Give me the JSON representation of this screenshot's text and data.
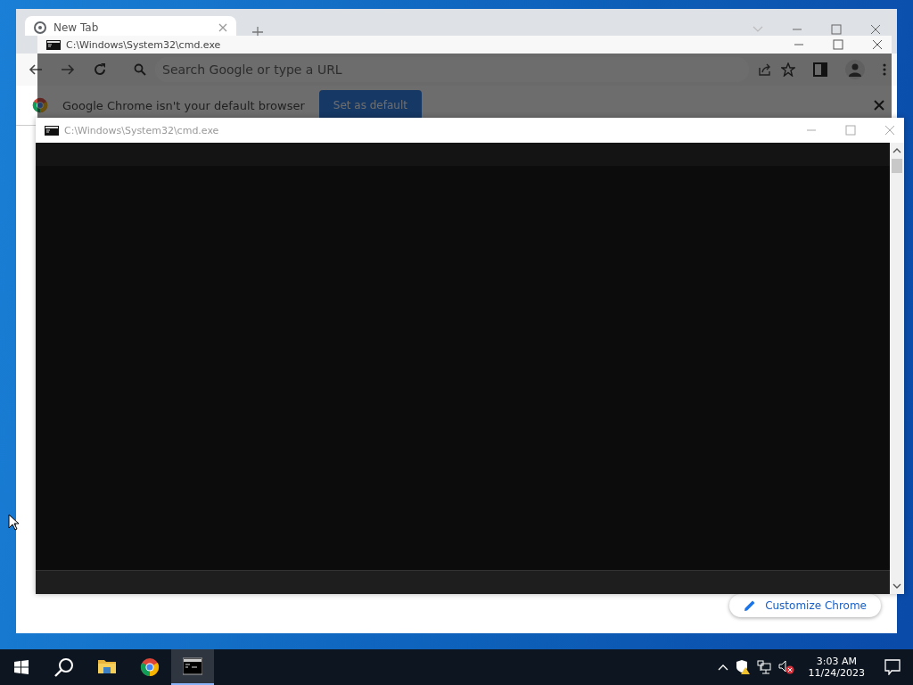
{
  "browser": {
    "tab": {
      "title": "New Tab"
    },
    "address_bar": {
      "placeholder": "Search Google or type a URL"
    },
    "infobar": {
      "message": "Google Chrome isn't your default browser",
      "button": "Set as default"
    },
    "customize_button": "Customize Chrome"
  },
  "console_windows": [
    {
      "title": "C:\\Windows\\System32\\cmd.exe"
    },
    {
      "title": "C:\\Windows\\System32\\cmd.exe"
    }
  ],
  "taskbar": {
    "apps": [
      {
        "kind": "folder",
        "active": false
      },
      {
        "kind": "chrome",
        "active": false
      },
      {
        "kind": "terminal",
        "active": true
      }
    ],
    "clock": {
      "time": "3:03 AM",
      "date": "11/24/2023"
    }
  }
}
